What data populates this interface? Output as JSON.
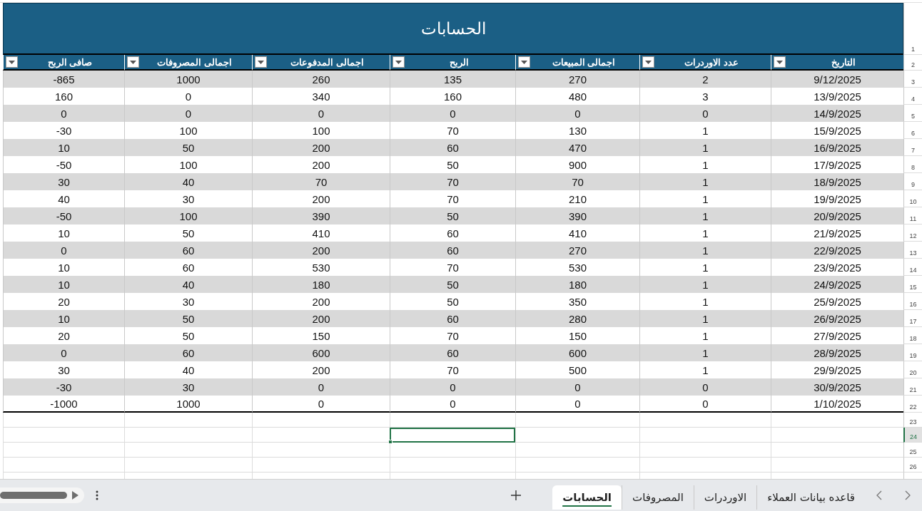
{
  "sheet": {
    "title_row": {
      "row_number": "1",
      "title": "الحسابات"
    },
    "header_row_number": "2",
    "data_row_numbers": [
      "3",
      "4",
      "5",
      "6",
      "7",
      "8",
      "9",
      "10",
      "11",
      "12",
      "13",
      "14",
      "15",
      "16",
      "17",
      "18",
      "19",
      "20",
      "21",
      "22"
    ],
    "columns": [
      {
        "header": "التاريخ",
        "cells": [
          "9/12/2025",
          "13/9/2025",
          "14/9/2025",
          "15/9/2025",
          "16/9/2025",
          "17/9/2025",
          "18/9/2025",
          "19/9/2025",
          "20/9/2025",
          "21/9/2025",
          "22/9/2025",
          "23/9/2025",
          "24/9/2025",
          "25/9/2025",
          "26/9/2025",
          "27/9/2025",
          "28/9/2025",
          "29/9/2025",
          "30/9/2025",
          "1/10/2025"
        ]
      },
      {
        "header": "عدد الاوردرات",
        "cells": [
          "2",
          "3",
          "0",
          "1",
          "1",
          "1",
          "1",
          "1",
          "1",
          "1",
          "1",
          "1",
          "1",
          "1",
          "1",
          "1",
          "1",
          "1",
          "0",
          "0"
        ]
      },
      {
        "header": "اجمالى المبيعات",
        "cells": [
          "270",
          "480",
          "0",
          "130",
          "470",
          "900",
          "70",
          "210",
          "390",
          "410",
          "270",
          "530",
          "180",
          "350",
          "280",
          "150",
          "600",
          "500",
          "0",
          "0"
        ]
      },
      {
        "header": "الربح",
        "cells": [
          "135",
          "160",
          "0",
          "70",
          "60",
          "50",
          "70",
          "70",
          "50",
          "60",
          "60",
          "70",
          "50",
          "50",
          "60",
          "70",
          "60",
          "70",
          "0",
          "0"
        ]
      },
      {
        "header": "اجمالى المدفوعات",
        "cells": [
          "260",
          "340",
          "0",
          "100",
          "200",
          "200",
          "70",
          "200",
          "390",
          "410",
          "200",
          "530",
          "180",
          "200",
          "200",
          "150",
          "600",
          "200",
          "0",
          "0"
        ]
      },
      {
        "header": "اجمالى المصروفات",
        "cells": [
          "1000",
          "0",
          "0",
          "100",
          "50",
          "100",
          "40",
          "30",
          "100",
          "50",
          "60",
          "60",
          "40",
          "30",
          "50",
          "50",
          "60",
          "40",
          "30",
          "1000"
        ]
      },
      {
        "header": "صافى الربح",
        "cells": [
          "-865",
          "160",
          "0",
          "-30",
          "10",
          "-50",
          "30",
          "40",
          "-50",
          "10",
          "0",
          "10",
          "10",
          "20",
          "10",
          "20",
          "0",
          "30",
          "-30",
          "-1000"
        ]
      }
    ],
    "empty_rows": [
      {
        "row_number": "23",
        "selected": false,
        "cells": [
          {
            "selected": false
          },
          {
            "selected": false
          },
          {
            "selected": false
          },
          {
            "selected": false
          },
          {
            "selected": false
          },
          {
            "selected": false
          },
          {
            "selected": false
          }
        ]
      },
      {
        "row_number": "24",
        "selected": true,
        "cells": [
          {
            "selected": false
          },
          {
            "selected": false
          },
          {
            "selected": false
          },
          {
            "selected": true
          },
          {
            "selected": false
          },
          {
            "selected": false
          },
          {
            "selected": false
          }
        ]
      },
      {
        "row_number": "25",
        "selected": false,
        "cells": [
          {
            "selected": false
          },
          {
            "selected": false
          },
          {
            "selected": false
          },
          {
            "selected": false
          },
          {
            "selected": false
          },
          {
            "selected": false
          },
          {
            "selected": false
          }
        ]
      },
      {
        "row_number": "26",
        "selected": false,
        "cells": [
          {
            "selected": false
          },
          {
            "selected": false
          },
          {
            "selected": false
          },
          {
            "selected": false
          },
          {
            "selected": false
          },
          {
            "selected": false
          },
          {
            "selected": false
          }
        ]
      }
    ]
  },
  "sheet_tabs": [
    {
      "label": "قاعده بيانات العملاء",
      "selected": false
    },
    {
      "label": "الاوردرات",
      "selected": false
    },
    {
      "label": "المصروفات",
      "selected": false
    },
    {
      "label": "الحسابات",
      "selected": true
    }
  ]
}
